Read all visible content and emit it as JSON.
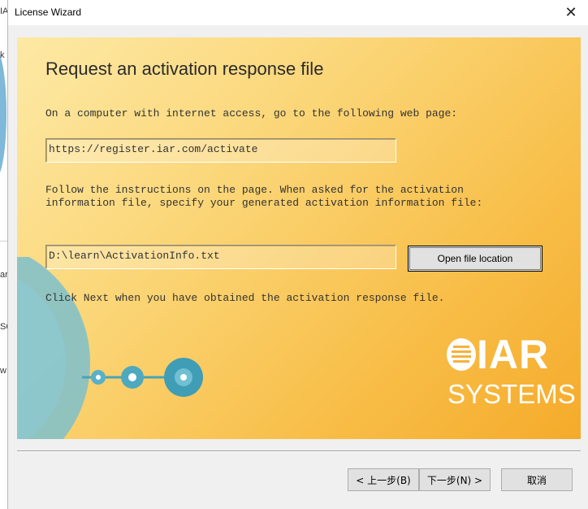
{
  "window": {
    "title": "License Wizard",
    "close_glyph": "✕"
  },
  "page": {
    "heading": "Request an activation response file",
    "instruction_1": "On a computer with internet access, go to the following web page:",
    "url_value": "https://register.iar.com/activate",
    "instruction_2": "Follow the instructions on the page. When asked for the activation\ninformation file, specify your generated activation information file:",
    "file_path_value": "D:\\learn\\ActivationInfo.txt",
    "open_location_label": "Open file location",
    "instruction_3": "Click Next when you have obtained the activation response file."
  },
  "logo": {
    "line1": "IAR",
    "line2": "SYSTEMS"
  },
  "buttons": {
    "back_label": "< 上一步(B)",
    "next_label": "下一步(N) >",
    "cancel_label": "取消"
  },
  "background_window": {
    "fragments": [
      "IA",
      "k",
      "ar",
      "S6",
      "w"
    ]
  },
  "colors": {
    "panel_light": "#fde9a5",
    "panel_dark": "#f5ab2b",
    "disc_blue": "#6bb5c9"
  }
}
